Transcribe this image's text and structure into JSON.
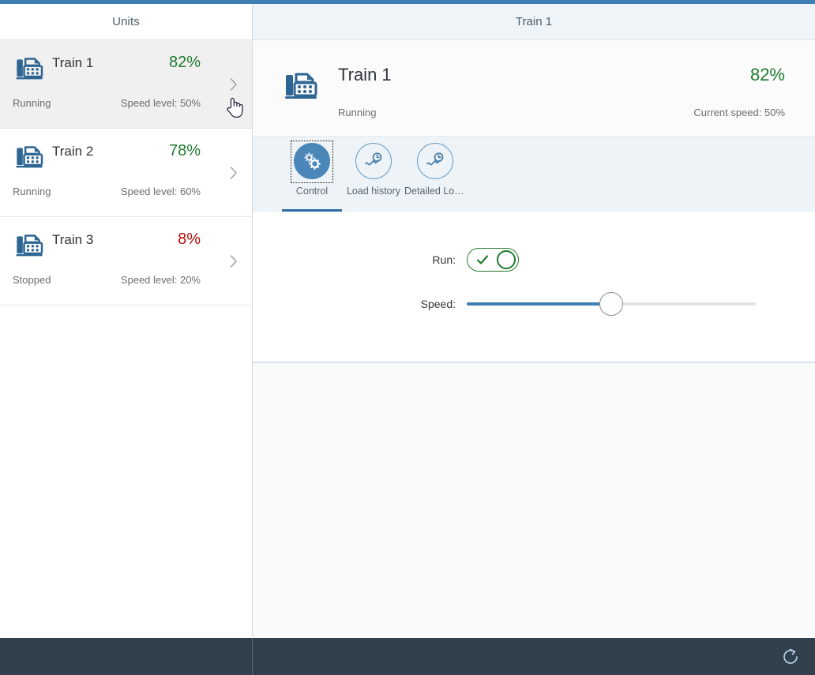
{
  "shell": {
    "accent_color": "#3f7fb3",
    "footer_color": "#323f4d"
  },
  "master": {
    "header_title": "Units",
    "items": [
      {
        "name": "Train 1",
        "percent": "82%",
        "percent_state": "good",
        "status": "Running",
        "speed": "Speed level: 50%",
        "icon": "fax-icon",
        "selected": true
      },
      {
        "name": "Train 2",
        "percent": "78%",
        "percent_state": "good",
        "status": "Running",
        "speed": "Speed level: 60%",
        "icon": "fax-icon",
        "selected": false
      },
      {
        "name": "Train 3",
        "percent": "8%",
        "percent_state": "bad",
        "status": "Stopped",
        "speed": "Speed level: 20%",
        "icon": "fax-icon",
        "selected": false
      }
    ]
  },
  "detail": {
    "header_title": "Train 1",
    "object": {
      "title": "Train 1",
      "status": "Running",
      "percent": "82%",
      "current_speed": "Current speed: 50%",
      "icon": "fax-icon"
    },
    "tabs": [
      {
        "label": "Control",
        "icon": "gears-icon",
        "active": true
      },
      {
        "label": "Load history",
        "icon": "load-history-icon",
        "active": false
      },
      {
        "label": "Detailed Loa…",
        "icon": "detailed-load-icon",
        "active": false
      }
    ],
    "control": {
      "run_label": "Run:",
      "run_value": "on",
      "speed_label": "Speed:",
      "speed_value": 50
    }
  },
  "footer": {
    "refresh_icon": "refresh-icon"
  },
  "colors": {
    "good": "#1d7b2e",
    "bad": "#b00d0d",
    "brand_blue": "#3f7fb3",
    "tab_active_underline": "#2b6ca3",
    "toggle_green": "#1d7b2e"
  }
}
